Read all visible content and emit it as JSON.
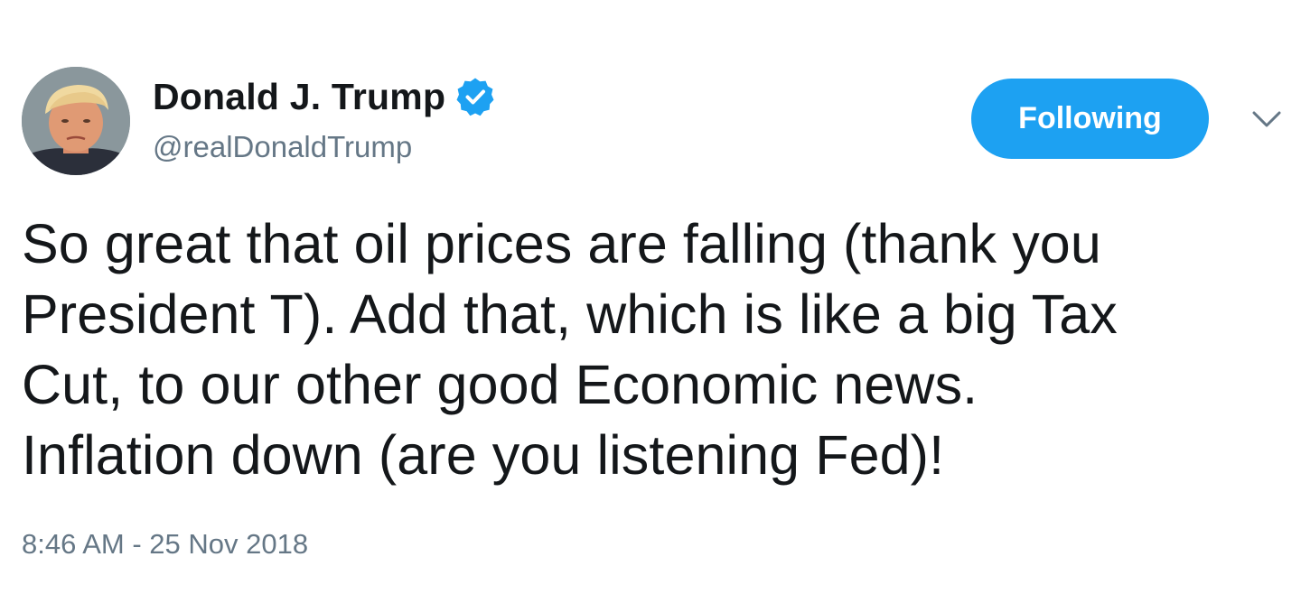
{
  "user": {
    "display_name": "Donald J. Trump",
    "handle": "@realDonaldTrump",
    "verified": true,
    "avatar_icon": "profile-photo"
  },
  "actions": {
    "follow_label": "Following",
    "more_icon": "chevron-down-icon"
  },
  "tweet": {
    "lines": [
      "So great that oil prices are falling (thank you",
      "President T). Add that, which is like a big Tax",
      "Cut, to our other good Economic news.",
      "Inflation down (are you listening Fed)!"
    ],
    "timestamp": "8:46 AM - 25 Nov 2018"
  },
  "colors": {
    "accent": "#1da1f2",
    "text": "#14171a",
    "secondary_text": "#657786",
    "background": "#ffffff"
  }
}
